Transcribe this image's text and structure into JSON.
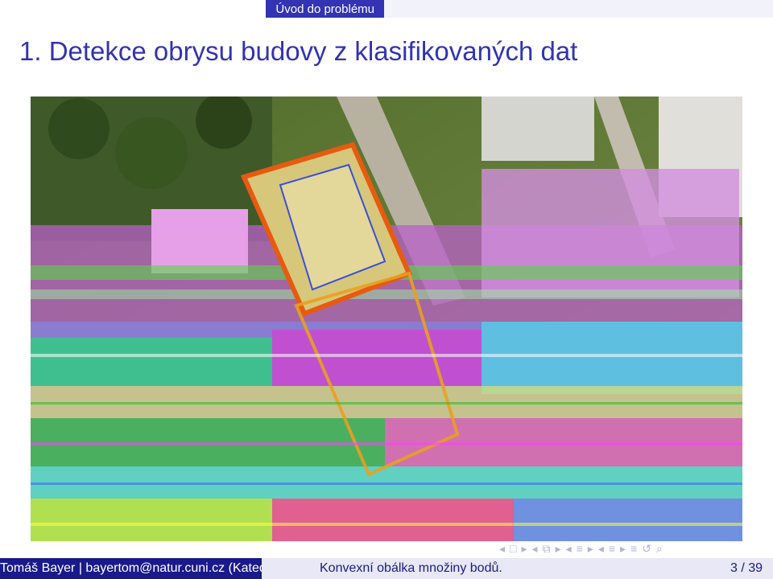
{
  "header": {
    "section": "Úvod do problému",
    "title": "1. Detekce obrysu budovy z klasifikovaných dat"
  },
  "figure": {
    "description_icon": "aerial-image-with-building-outline"
  },
  "navigation": {
    "icons": [
      "frame-prev-icon",
      "frame-icon",
      "frame-next-icon",
      "subsection-prev-icon",
      "subsection-icon",
      "subsection-next-icon",
      "section-prev-icon",
      "section-icon",
      "section-next-icon",
      "doc-prev-icon",
      "doc-icon",
      "doc-next-icon",
      "back-icon",
      "search-icon"
    ]
  },
  "footer": {
    "left": "Tomáš Bayer | bayertom@natur.cuni.cz (Katedra aplikované geoinformatiky a kartografie)",
    "title": "Konvexní obálka množiny bodů.",
    "page": "3 / 39"
  }
}
